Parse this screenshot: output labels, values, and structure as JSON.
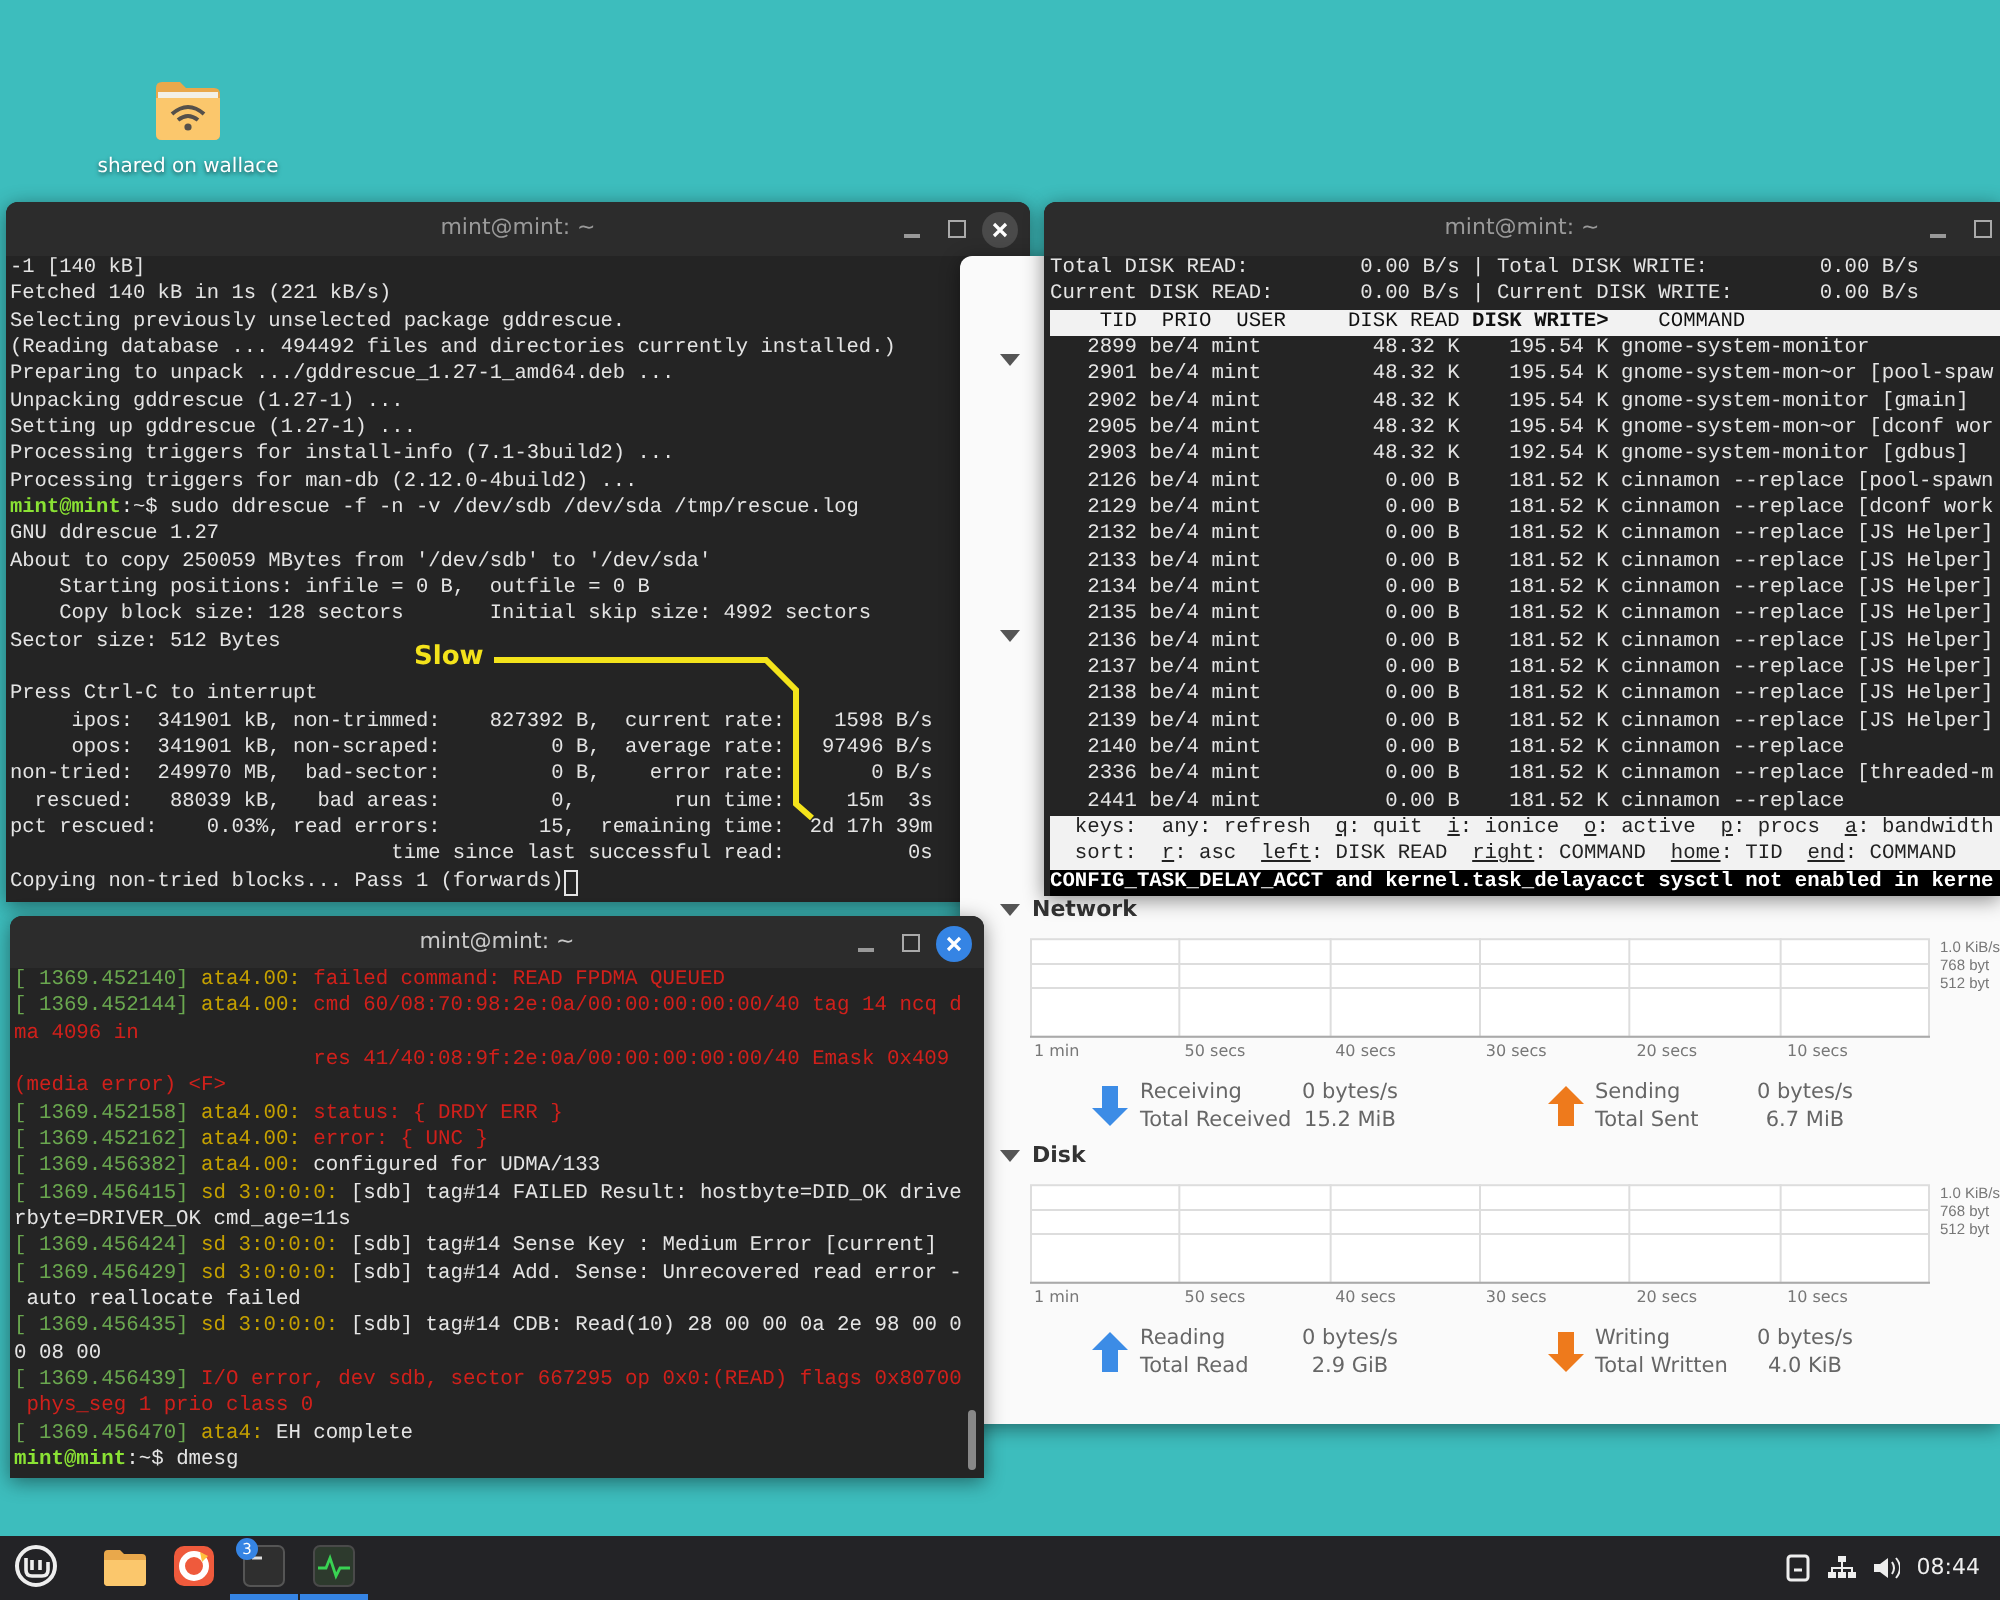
{
  "desktop": {
    "icons": [
      {
        "label": "shared on wallace"
      }
    ]
  },
  "ddrescue_terminal": {
    "title": "mint@mint: ~",
    "focused": false,
    "controls": [
      {
        "kind": "minimize"
      },
      {
        "kind": "maximize"
      },
      {
        "kind": "close"
      }
    ],
    "cursor": true,
    "rows": [
      "-1 [140 kB]",
      "Fetched 140 kB in 1s (221 kB/s)",
      "Selecting previously unselected package gddrescue.",
      "(Reading database ... 494492 files and directories currently installed.)",
      "Preparing to unpack .../gddrescue_1.27-1_amd64.deb ...",
      "Unpacking gddrescue (1.27-1) ...",
      "Setting up gddrescue (1.27-1) ...",
      "Processing triggers for install-info (7.1-3build2) ...",
      "Processing triggers for man-db (2.12.0-4build2) ...",
      {
        "parts": [
          {
            "kind": "prompt",
            "text": "mint@mint"
          },
          {
            "kind": "text",
            "text": ":~$ sudo ddrescue -f -n -v /dev/sdb /dev/sda /tmp/rescue.log"
          }
        ]
      },
      "GNU ddrescue 1.27",
      "About to copy 250059 MBytes from '/dev/sdb' to '/dev/sda'",
      "    Starting positions: infile = 0 B,  outfile = 0 B",
      "    Copy block size: 128 sectors       Initial skip size: 4992 sectors",
      "Sector size: 512 Bytes",
      {
        "parts": [
          {
            "kind": "text",
            "text": "Press Ctrl-C to interrupt"
          }
        ],
        "blank_before": true
      },
      "     ipos:  341901 kB, non-trimmed:    827392 B,  current rate:    1598 B/s",
      "     opos:  341901 kB, non-scraped:         0 B,  average rate:   97496 B/s",
      "non-tried:  249970 MB,  bad-sector:         0 B,    error rate:       0 B/s",
      "  rescued:   88039 kB,   bad areas:         0,        run time:     15m  3s",
      "pct rescued:    0.03%, read errors:        15,  remaining time:  2d 17h 39m",
      "                               time since last successful read:          0s",
      "Copying non-tried blocks... Pass 1 (forwards)"
    ],
    "annotation": {
      "label": "Slow"
    }
  },
  "iotop_terminal": {
    "title": "mint@mint: ~",
    "focused": false,
    "controls": [
      {
        "kind": "minimize"
      },
      {
        "kind": "maximize"
      }
    ],
    "summary_rows": [
      "Total DISK READ:         0.00 B/s | Total DISK WRITE:         0.00 B/s",
      "Current DISK READ:       0.00 B/s | Current DISK WRITE:       0.00 B/s"
    ],
    "column_header": [
      {
        "kind": "text",
        "text": "    TID  PRIO  USER     DISK READ "
      },
      {
        "kind": "sort",
        "text": "DISK WRITE>"
      },
      {
        "kind": "text",
        "text": "    COMMAND"
      }
    ],
    "rows": [
      "   2899 be/4 mint         48.32 K    195.54 K gnome-system-monitor",
      "   2901 be/4 mint         48.32 K    195.54 K gnome-system-mon~or [pool-spaw",
      "   2902 be/4 mint         48.32 K    195.54 K gnome-system-monitor [gmain]",
      "   2905 be/4 mint         48.32 K    195.54 K gnome-system-mon~or [dconf wor",
      "   2903 be/4 mint         48.32 K    192.54 K gnome-system-monitor [gdbus]",
      "   2126 be/4 mint          0.00 B    181.52 K cinnamon --replace [pool-spawn",
      "   2129 be/4 mint          0.00 B    181.52 K cinnamon --replace [dconf work",
      "   2132 be/4 mint          0.00 B    181.52 K cinnamon --replace [JS Helper]",
      "   2133 be/4 mint          0.00 B    181.52 K cinnamon --replace [JS Helper]",
      "   2134 be/4 mint          0.00 B    181.52 K cinnamon --replace [JS Helper]",
      "   2135 be/4 mint          0.00 B    181.52 K cinnamon --replace [JS Helper]",
      "   2136 be/4 mint          0.00 B    181.52 K cinnamon --replace [JS Helper]",
      "   2137 be/4 mint          0.00 B    181.52 K cinnamon --replace [JS Helper]",
      "   2138 be/4 mint          0.00 B    181.52 K cinnamon --replace [JS Helper]",
      "   2139 be/4 mint          0.00 B    181.52 K cinnamon --replace [JS Helper]",
      "   2140 be/4 mint          0.00 B    181.52 K cinnamon --replace",
      "   2336 be/4 mint          0.00 B    181.52 K cinnamon --replace [threaded-m",
      "   2441 be/4 mint          0.00 B    181.52 K cinnamon --replace"
    ],
    "key_rows": [
      [
        {
          "kind": "text",
          "text": "  keys:  any: refresh  "
        },
        {
          "kind": "key",
          "text": "q"
        },
        {
          "kind": "text",
          "text": ": quit  "
        },
        {
          "kind": "key",
          "text": "i"
        },
        {
          "kind": "text",
          "text": ": ionice  "
        },
        {
          "kind": "key",
          "text": "o"
        },
        {
          "kind": "text",
          "text": ": active  "
        },
        {
          "kind": "key",
          "text": "p"
        },
        {
          "kind": "text",
          "text": ": procs  "
        },
        {
          "kind": "key",
          "text": "a"
        },
        {
          "kind": "text",
          "text": ": bandwidth"
        }
      ],
      [
        {
          "kind": "text",
          "text": "  sort:  "
        },
        {
          "kind": "key",
          "text": "r"
        },
        {
          "kind": "text",
          "text": ": asc  "
        },
        {
          "kind": "key",
          "text": "left"
        },
        {
          "kind": "text",
          "text": ": DISK READ  "
        },
        {
          "kind": "key",
          "text": "right"
        },
        {
          "kind": "text",
          "text": ": COMMAND  "
        },
        {
          "kind": "key",
          "text": "home"
        },
        {
          "kind": "text",
          "text": ": TID  "
        },
        {
          "kind": "key",
          "text": "end"
        },
        {
          "kind": "text",
          "text": ": COMMAND"
        }
      ]
    ],
    "status_line": "CONFIG_TASK_DELAY_ACCT and kernel.task_delayacct sysctl not enabled in kerne"
  },
  "system_monitor": {
    "sections": [
      {
        "kind": "stub",
        "expanded": true
      },
      {
        "kind": "stub",
        "expanded": true
      },
      {
        "kind": "graph",
        "heading": "Network",
        "expanded": true,
        "x_labels": [
          "1 min",
          "50 secs",
          "40 secs",
          "30 secs",
          "20 secs",
          "10 secs"
        ],
        "y_labels": [
          "1.0 KiB/s",
          "768 byt",
          "512 byt"
        ],
        "legend": [
          {
            "kind": "down",
            "color": "#3c8ce6",
            "label": "Receiving",
            "total_label": "Total Received",
            "rate": "0 bytes/s",
            "total": "15.2 MiB"
          },
          {
            "kind": "up",
            "color": "#ee7a1c",
            "label": "Sending",
            "total_label": "Total Sent",
            "rate": "0 bytes/s",
            "total": "6.7 MiB"
          }
        ]
      },
      {
        "kind": "graph",
        "heading": "Disk",
        "expanded": true,
        "x_labels": [
          "1 min",
          "50 secs",
          "40 secs",
          "30 secs",
          "20 secs",
          "10 secs"
        ],
        "y_labels": [
          "1.0 KiB/s",
          "768 byt",
          "512 byt"
        ],
        "legend": [
          {
            "kind": "up",
            "color": "#3c8ce6",
            "label": "Reading",
            "total_label": "Total Read",
            "rate": "0 bytes/s",
            "total": "2.9 GiB"
          },
          {
            "kind": "down",
            "color": "#ee7a1c",
            "label": "Writing",
            "total_label": "Total Written",
            "rate": "0 bytes/s",
            "total": "4.0 KiB"
          }
        ]
      }
    ]
  },
  "dmesg_terminal": {
    "title": "mint@mint: ~",
    "focused": true,
    "controls": [
      {
        "kind": "minimize"
      },
      {
        "kind": "maximize"
      },
      {
        "kind": "close"
      }
    ],
    "rows": [
      {
        "parts": [
          {
            "kind": "ts",
            "text": "[ 1369.452140]"
          },
          {
            "kind": "dev",
            "text": " ata4.00: "
          },
          {
            "kind": "err",
            "text": "failed command: READ FPDMA QUEUED"
          }
        ]
      },
      {
        "parts": [
          {
            "kind": "ts",
            "text": "[ 1369.452144]"
          },
          {
            "kind": "dev",
            "text": " ata4.00: "
          },
          {
            "kind": "err",
            "text": "cmd 60/08:70:98:2e:0a/00:00:00:00:00/40 tag 14 ncq d"
          }
        ]
      },
      {
        "parts": [
          {
            "kind": "err",
            "text": "ma 4096 in"
          }
        ]
      },
      {
        "parts": [
          {
            "kind": "err",
            "text": "                        res 41/40:08:9f:2e:0a/00:00:00:00:00/40 Emask 0x409"
          }
        ]
      },
      {
        "parts": [
          {
            "kind": "err",
            "text": "(media error) <F>"
          }
        ]
      },
      {
        "parts": [
          {
            "kind": "ts",
            "text": "[ 1369.452158]"
          },
          {
            "kind": "dev",
            "text": " ata4.00: "
          },
          {
            "kind": "err",
            "text": "status: { DRDY ERR }"
          }
        ]
      },
      {
        "parts": [
          {
            "kind": "ts",
            "text": "[ 1369.452162]"
          },
          {
            "kind": "dev",
            "text": " ata4.00: "
          },
          {
            "kind": "err",
            "text": "error: { UNC }"
          }
        ]
      },
      {
        "parts": [
          {
            "kind": "ts",
            "text": "[ 1369.456382]"
          },
          {
            "kind": "dev",
            "text": " ata4.00: "
          },
          {
            "kind": "text",
            "text": "configured for UDMA/133"
          }
        ]
      },
      {
        "parts": [
          {
            "kind": "ts",
            "text": "[ 1369.456415]"
          },
          {
            "kind": "dev",
            "text": " sd 3:0:0:0: "
          },
          {
            "kind": "text",
            "text": "[sdb] tag#14 FAILED Result: hostbyte=DID_OK drive"
          }
        ]
      },
      "rbyte=DRIVER_OK cmd_age=11s",
      {
        "parts": [
          {
            "kind": "ts",
            "text": "[ 1369.456424]"
          },
          {
            "kind": "dev",
            "text": " sd 3:0:0:0: "
          },
          {
            "kind": "text",
            "text": "[sdb] tag#14 Sense Key : Medium Error [current]"
          }
        ]
      },
      {
        "parts": [
          {
            "kind": "ts",
            "text": "[ 1369.456429]"
          },
          {
            "kind": "dev",
            "text": " sd 3:0:0:0: "
          },
          {
            "kind": "text",
            "text": "[sdb] tag#14 Add. Sense: Unrecovered read error -"
          }
        ]
      },
      " auto reallocate failed",
      {
        "parts": [
          {
            "kind": "ts",
            "text": "[ 1369.456435]"
          },
          {
            "kind": "dev",
            "text": " sd 3:0:0:0: "
          },
          {
            "kind": "text",
            "text": "[sdb] tag#14 CDB: Read(10) 28 00 00 0a 2e 98 00 0"
          }
        ]
      },
      "0 08 00",
      {
        "parts": [
          {
            "kind": "ts",
            "text": "[ 1369.456439]"
          },
          {
            "kind": "err",
            "text": " I/O error, dev sdb, sector 667295 op 0x0:(READ) flags 0x80700"
          }
        ]
      },
      {
        "parts": [
          {
            "kind": "err",
            "text": " phys_seg 1 prio class 0"
          }
        ]
      },
      {
        "parts": [
          {
            "kind": "ts",
            "text": "[ 1369.456470]"
          },
          {
            "kind": "dev",
            "text": " ata4: "
          },
          {
            "kind": "text",
            "text": "EH complete"
          }
        ]
      },
      {
        "parts": [
          {
            "kind": "prompt",
            "text": "mint@mint"
          },
          {
            "kind": "text",
            "text": ":~$ dmesg"
          }
        ]
      }
    ]
  },
  "taskbar": {
    "launchers": [
      {
        "kind": "menu",
        "running": false
      },
      {
        "kind": "files",
        "running": false
      },
      {
        "kind": "browser",
        "running": false
      },
      {
        "kind": "terminal",
        "running": true,
        "badge": "3"
      },
      {
        "kind": "monitor",
        "running": true
      }
    ],
    "tray": [
      {
        "kind": "notes"
      },
      {
        "kind": "network"
      },
      {
        "kind": "volume"
      }
    ],
    "clock": "08:44"
  }
}
